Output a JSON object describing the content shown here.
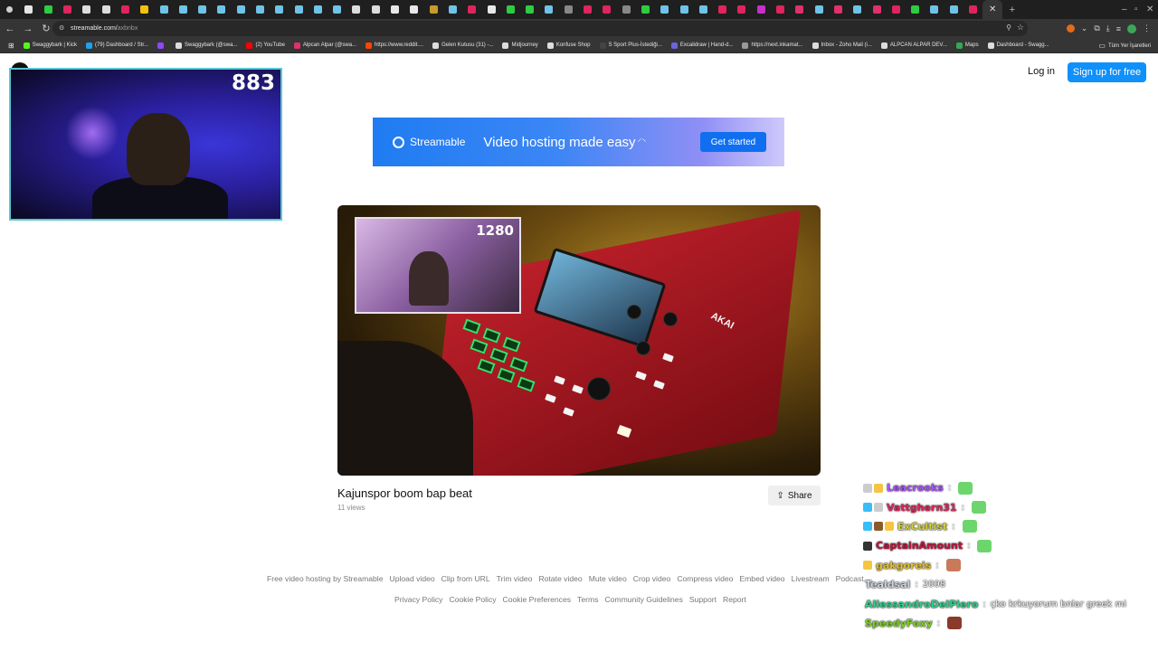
{
  "browser": {
    "url_host": "streamable.com/",
    "url_path": "axbnbx",
    "active_tab_close": "✕",
    "new_tab": "+",
    "tab_favicon_colors": [
      "#e5e5e5",
      "#2ecc40",
      "#e0245e",
      "#dddddd",
      "#dddddd",
      "#e0245e",
      "#f4c20d",
      "#6fc3e8",
      "#6fc3e8",
      "#6fc3e8",
      "#6fc3e8",
      "#6fc3e8",
      "#6fc3e8",
      "#6fc3e8",
      "#6fc3e8",
      "#6fc3e8",
      "#6fc3e8",
      "#dddddd",
      "#dddddd",
      "#e8e8e8",
      "#e8e8e8",
      "#c79a2a",
      "#6fc3e8",
      "#e0245e",
      "#e8e8e8",
      "#2ecc40",
      "#2ecc40",
      "#6fc3e8",
      "#888888",
      "#e0245e",
      "#e0245e",
      "#888888",
      "#2ecc40",
      "#6fc3e8",
      "#6fc3e8",
      "#6fc3e8",
      "#e0245e",
      "#e0245e",
      "#c830c8",
      "#e0245e",
      "#e1306c",
      "#6fc3e8",
      "#e1306c",
      "#6fc3e8",
      "#e1306c",
      "#e0245e",
      "#2ecc40",
      "#6fc3e8",
      "#6fc3e8",
      "#e0245e"
    ],
    "bookmarks": [
      {
        "label": "Swaggybark | Kick",
        "color": "#53fc18"
      },
      {
        "label": "(79) Dashboard / Str...",
        "color": "#1da1f2"
      },
      {
        "label": "",
        "color": "#9146ff"
      },
      {
        "label": "Swaggybark (@swa...",
        "color": "#dddddd"
      },
      {
        "label": "(2) YouTube",
        "color": "#ff0000"
      },
      {
        "label": "Alpcan Alpar (@swa...",
        "color": "#e1306c"
      },
      {
        "label": "https://www.reddit....",
        "color": "#ff4500"
      },
      {
        "label": "Gelen Kutusu (31) -...",
        "color": "#dddddd"
      },
      {
        "label": "Midjourney",
        "color": "#dddddd"
      },
      {
        "label": "Konfuse Shop",
        "color": "#dddddd"
      },
      {
        "label": "S Sport Plus-İstediği...",
        "color": "#444444"
      },
      {
        "label": "Excalidraw | Hand-d...",
        "color": "#6965db"
      },
      {
        "label": "https://next.inkamat...",
        "color": "#999999"
      },
      {
        "label": "Inbox - Zoho Mail (i...",
        "color": "#dddddd"
      },
      {
        "label": "ALPCAN ALPAR DEV...",
        "color": "#dddddd"
      },
      {
        "label": "Maps",
        "color": "#34a853"
      },
      {
        "label": "Dashboard - Swagg...",
        "color": "#dddddd"
      }
    ],
    "other_bookmarks": "Tüm Yer İşaretleri"
  },
  "header": {
    "login_label": "Log in",
    "signup_label": "Sign up for free"
  },
  "banner": {
    "brand": "Streamable",
    "tagline": "Video hosting made easy",
    "cta_label": "Get started"
  },
  "video": {
    "title": "Kajunspor boom bap beat",
    "views": "11 views",
    "share_label": "Share",
    "pip_count": "1280",
    "device_brand": "AKAI"
  },
  "footer": {
    "row1": [
      "Free video hosting by Streamable",
      "Upload video",
      "Clip from URL",
      "Trim video",
      "Rotate video",
      "Mute video",
      "Crop video",
      "Compress video",
      "Embed video",
      "Livestream",
      "Podcast"
    ],
    "row2": [
      "Privacy Policy",
      "Cookie Policy",
      "Cookie Preferences",
      "Terms",
      "Community Guidelines",
      "Support",
      "Report"
    ]
  },
  "overlay": {
    "viewer_count": "883",
    "chat": [
      {
        "user": "Leacrooks",
        "color": "#a855f7",
        "sep": ":",
        "msg": "",
        "badges": [
          "#cccccc",
          "#f5c542"
        ],
        "emote": "#6cd66c"
      },
      {
        "user": "Vattghern31",
        "color": "#e0245e",
        "sep": ":",
        "msg": "",
        "badges": [
          "#38bdf8",
          "#cccccc"
        ],
        "emote": "#6cd66c"
      },
      {
        "user": "ExCultist",
        "color": "#d4d432",
        "sep": ":",
        "msg": "",
        "badges": [
          "#38bdf8",
          "#8b5a2b",
          "#f5c542"
        ],
        "emote": "#6cd66c"
      },
      {
        "user": "CaptainAmount",
        "color": "#c0143c",
        "sep": ":",
        "msg": "",
        "badges": [
          "#333333"
        ],
        "emote": "#6cd66c"
      },
      {
        "user": "gakgoreis",
        "color": "#e8c22a",
        "sep": ":",
        "msg": "",
        "badges": [
          "#f5c542"
        ],
        "emote": "#c97a5a"
      },
      {
        "user": "Tealdsal",
        "color": "#cfd6e3",
        "sep": ":",
        "msg": "2008",
        "badges": [],
        "emote": ""
      },
      {
        "user": "AllessandroDelPiero",
        "color": "#2ed18a",
        "sep": ":",
        "msg": "çko krkuyorum bnlar greek mi",
        "badges": [],
        "emote": ""
      },
      {
        "user": "SpeedyFoxy",
        "color": "#7ed321",
        "sep": ":",
        "msg": "",
        "badges": [],
        "emote": "#8a3a2a"
      }
    ]
  }
}
